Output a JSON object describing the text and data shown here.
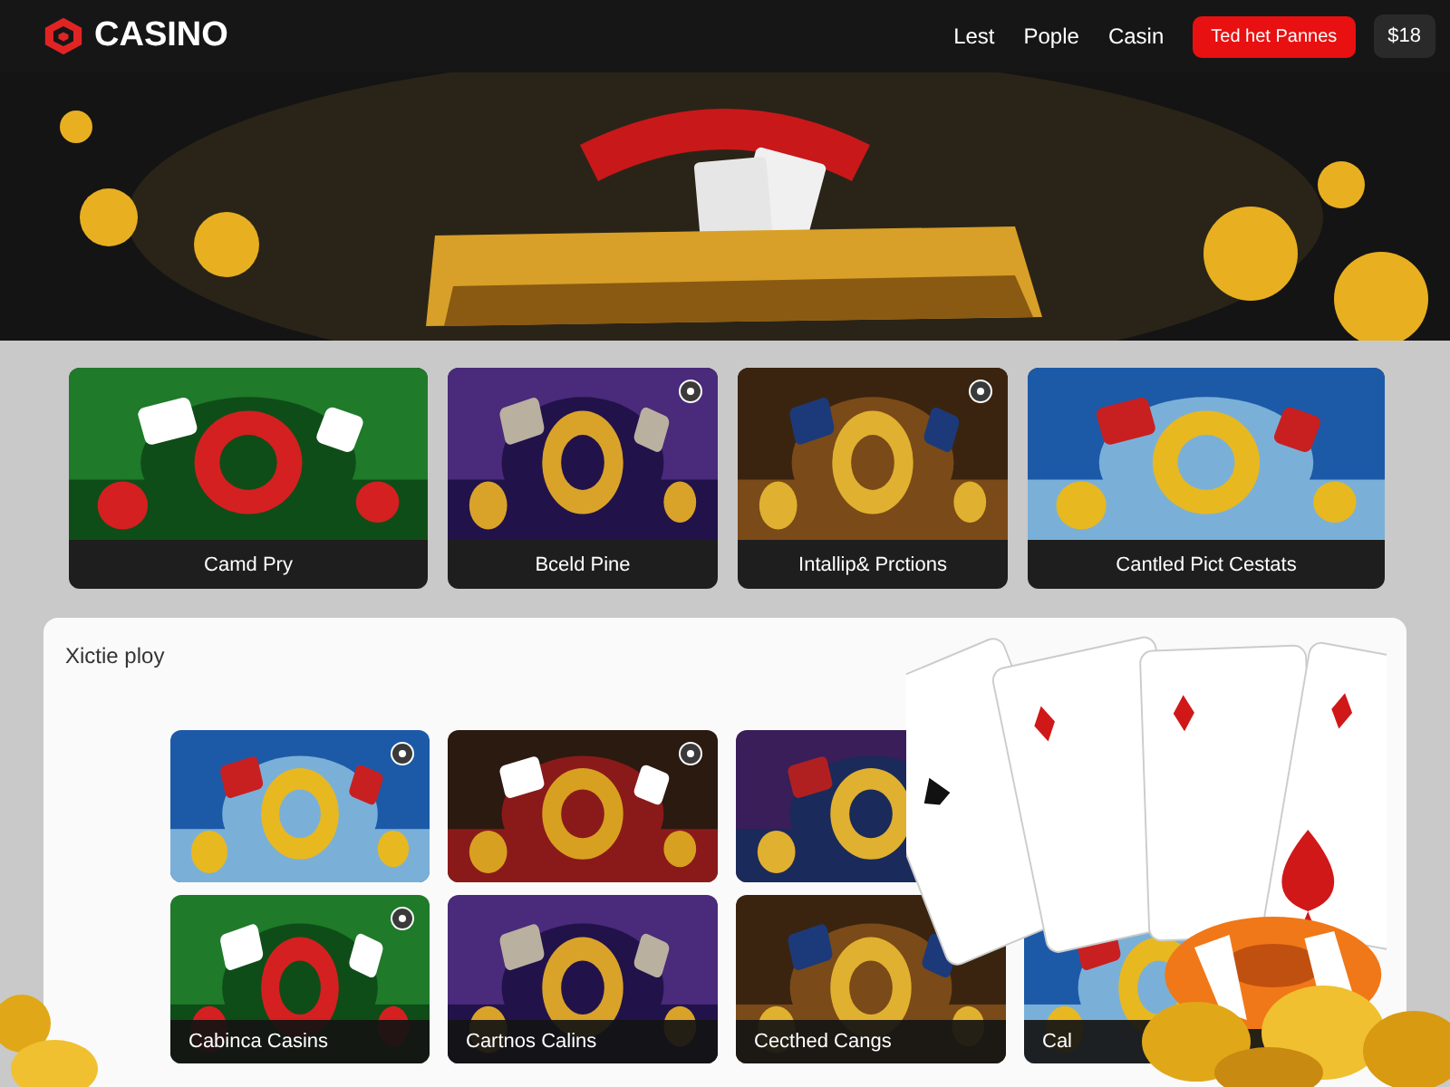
{
  "header": {
    "logo": "CASINO",
    "nav": [
      "Lest",
      "Pople",
      "Casin"
    ],
    "cta": "Ted het Pannes",
    "balance": "$18"
  },
  "featured": [
    {
      "label": "Camd Pry",
      "icon": false
    },
    {
      "label": "Bceld Pine",
      "icon": true
    },
    {
      "label": "Intallip& Prctions",
      "icon": true
    },
    {
      "label": "Cantled Pict Cestats",
      "icon": false
    }
  ],
  "section": {
    "title": "Xictie ploy",
    "rows": [
      [
        {
          "icon": true
        },
        {
          "icon": true
        },
        {
          "icon": false
        }
      ],
      [
        {
          "label": "Cabinca Casins",
          "icon": true
        },
        {
          "label": "Cartnos Calins",
          "icon": false
        },
        {
          "label": "Cecthed Cangs",
          "icon": false
        },
        {
          "label": "Cal",
          "icon": false
        }
      ]
    ]
  }
}
